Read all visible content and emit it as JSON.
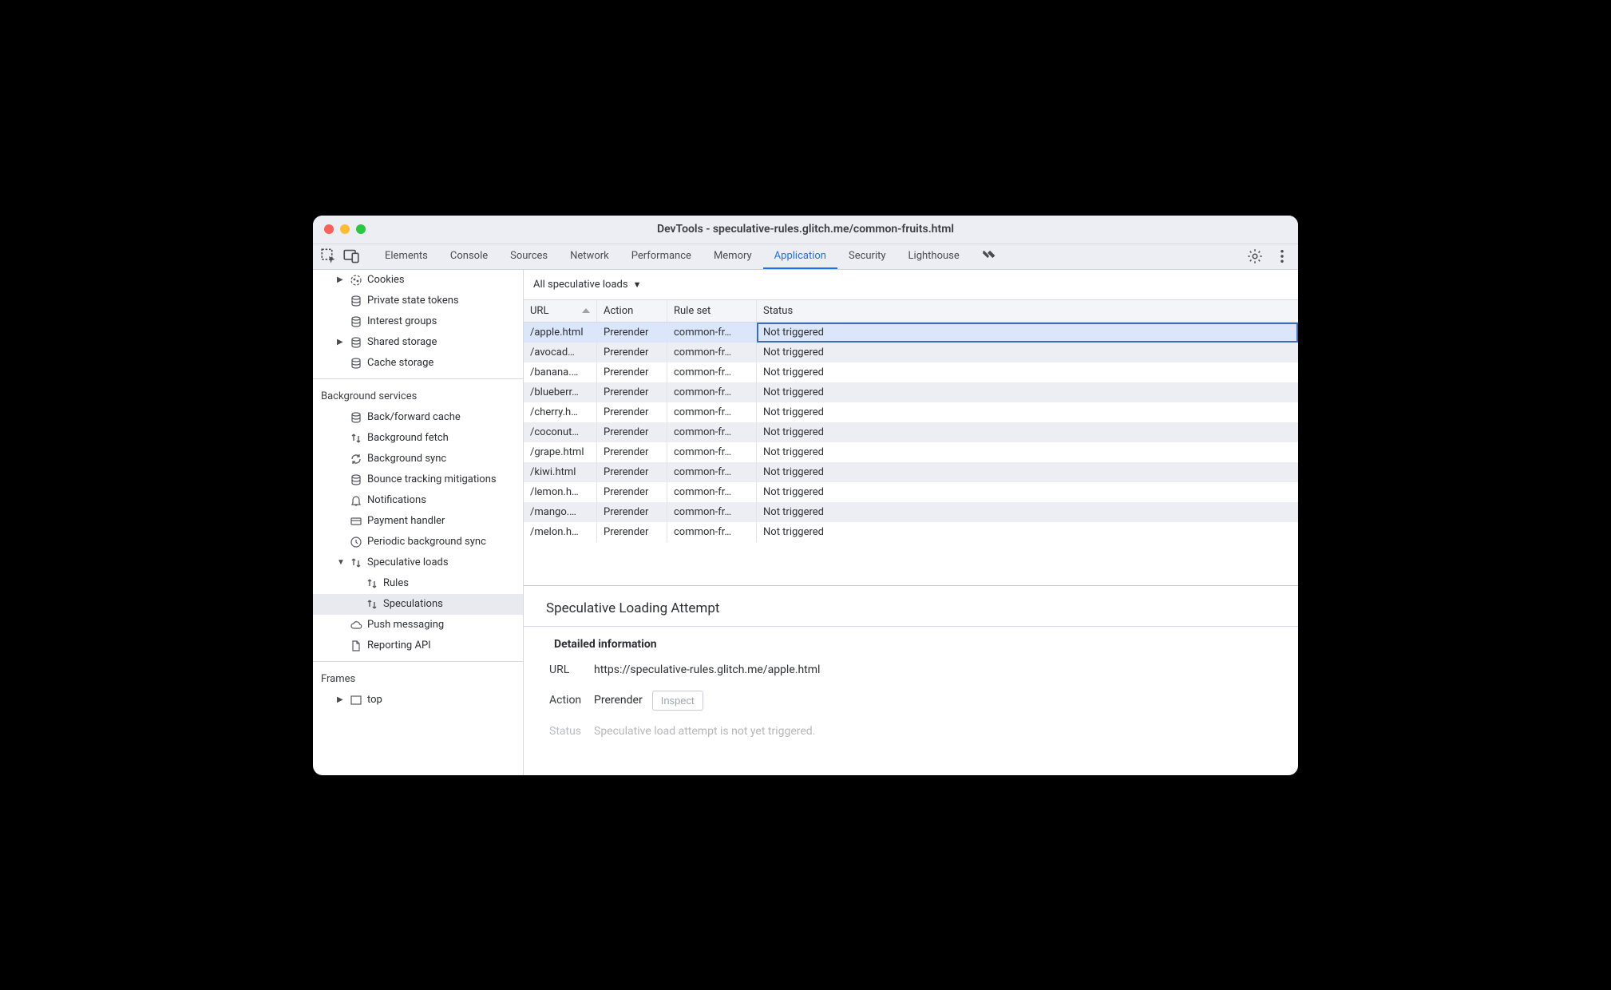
{
  "window": {
    "title": "DevTools - speculative-rules.glitch.me/common-fruits.html"
  },
  "tabs": {
    "items": [
      "Elements",
      "Console",
      "Sources",
      "Network",
      "Performance",
      "Memory",
      "Application",
      "Security",
      "Lighthouse"
    ],
    "active": "Application"
  },
  "sidebar": {
    "storage_items": [
      {
        "label": "Cookies",
        "icon": "cookie",
        "arrow": true
      },
      {
        "label": "Private state tokens",
        "icon": "db"
      },
      {
        "label": "Interest groups",
        "icon": "db"
      },
      {
        "label": "Shared storage",
        "icon": "db",
        "arrow": true
      },
      {
        "label": "Cache storage",
        "icon": "db"
      }
    ],
    "background_title": "Background services",
    "background_items": [
      {
        "label": "Back/forward cache",
        "icon": "db"
      },
      {
        "label": "Background fetch",
        "icon": "updown"
      },
      {
        "label": "Background sync",
        "icon": "sync"
      },
      {
        "label": "Bounce tracking mitigations",
        "icon": "db"
      },
      {
        "label": "Notifications",
        "icon": "bell"
      },
      {
        "label": "Payment handler",
        "icon": "card"
      },
      {
        "label": "Periodic background sync",
        "icon": "clock"
      },
      {
        "label": "Speculative loads",
        "icon": "updown",
        "arrow": "down",
        "children": [
          {
            "label": "Rules",
            "icon": "updown"
          },
          {
            "label": "Speculations",
            "icon": "updown",
            "selected": true
          }
        ]
      },
      {
        "label": "Push messaging",
        "icon": "cloud"
      },
      {
        "label": "Reporting API",
        "icon": "doc"
      }
    ],
    "frames_title": "Frames",
    "frames_items": [
      {
        "label": "top",
        "icon": "frame",
        "arrow": true
      }
    ]
  },
  "filter": {
    "label": "All speculative loads"
  },
  "table": {
    "columns": [
      "URL",
      "Action",
      "Rule set",
      "Status"
    ],
    "rows": [
      {
        "url": "/apple.html",
        "action": "Prerender",
        "ruleset": "common-fr…",
        "status": "Not triggered",
        "selected": true
      },
      {
        "url": "/avocad…",
        "action": "Prerender",
        "ruleset": "common-fr…",
        "status": "Not triggered"
      },
      {
        "url": "/banana.…",
        "action": "Prerender",
        "ruleset": "common-fr…",
        "status": "Not triggered"
      },
      {
        "url": "/blueberr…",
        "action": "Prerender",
        "ruleset": "common-fr…",
        "status": "Not triggered"
      },
      {
        "url": "/cherry.h…",
        "action": "Prerender",
        "ruleset": "common-fr…",
        "status": "Not triggered"
      },
      {
        "url": "/coconut…",
        "action": "Prerender",
        "ruleset": "common-fr…",
        "status": "Not triggered"
      },
      {
        "url": "/grape.html",
        "action": "Prerender",
        "ruleset": "common-fr…",
        "status": "Not triggered"
      },
      {
        "url": "/kiwi.html",
        "action": "Prerender",
        "ruleset": "common-fr…",
        "status": "Not triggered"
      },
      {
        "url": "/lemon.h…",
        "action": "Prerender",
        "ruleset": "common-fr…",
        "status": "Not triggered"
      },
      {
        "url": "/mango.…",
        "action": "Prerender",
        "ruleset": "common-fr…",
        "status": "Not triggered"
      },
      {
        "url": "/melon.h…",
        "action": "Prerender",
        "ruleset": "common-fr…",
        "status": "Not triggered"
      }
    ]
  },
  "detail": {
    "title": "Speculative Loading Attempt",
    "section": "Detailed information",
    "url_label": "URL",
    "url_value": "https://speculative-rules.glitch.me/apple.html",
    "action_label": "Action",
    "action_value": "Prerender",
    "inspect_label": "Inspect",
    "status_label": "Status",
    "status_value": "Speculative load attempt is not yet triggered."
  }
}
